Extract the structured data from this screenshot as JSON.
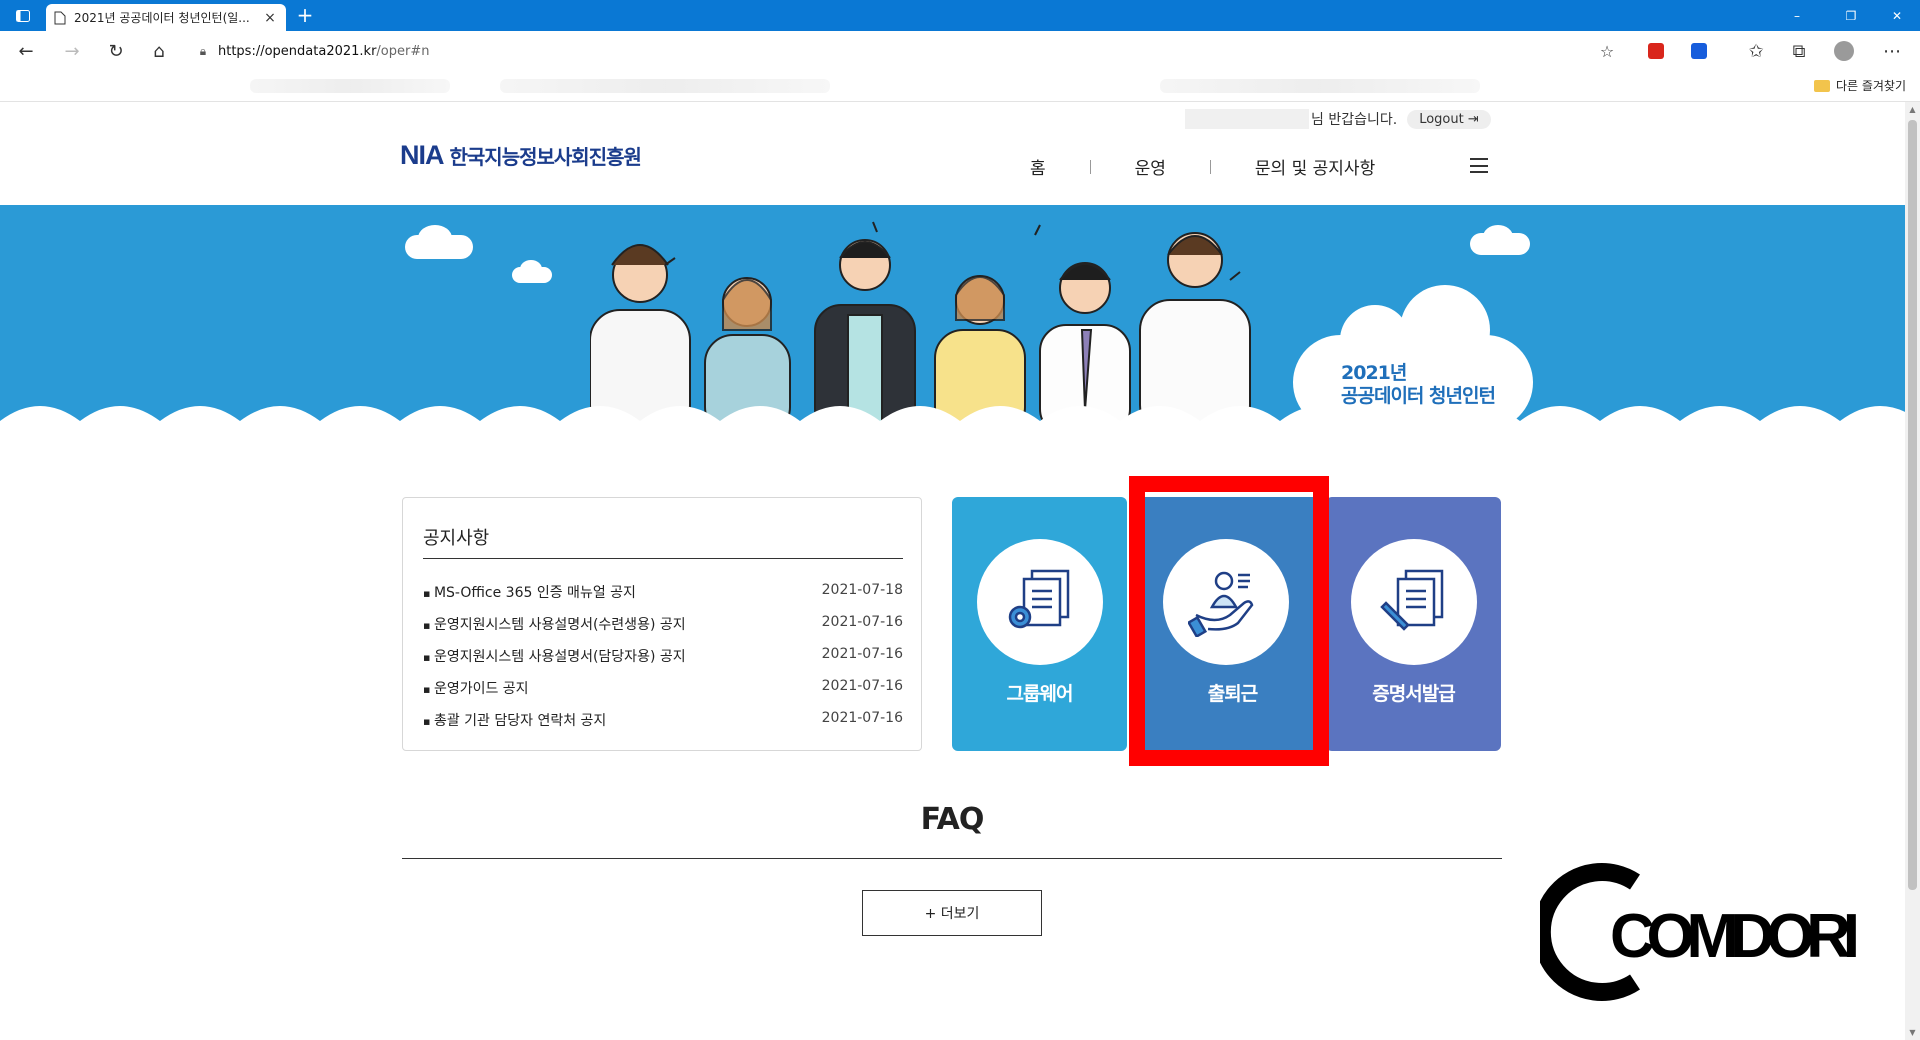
{
  "browser": {
    "tab_title": "2021년 공공데이터 청년인턴(일...",
    "tab_close": "×",
    "newtab": "+",
    "url_host": "https://opendata2021.kr",
    "url_path": "/oper#n",
    "other_favorites": "다른 즐겨찾기",
    "window_controls": {
      "minimize": "–",
      "restore": "❐",
      "close": "✕"
    }
  },
  "header": {
    "greeting": "님 반갑습니다.",
    "logout": "Logout",
    "logo_abbr": "NIA",
    "logo_org": "한국지능정보사회진흥원",
    "nav": [
      "홈",
      "운영",
      "문의 및 공지사항"
    ]
  },
  "banner": {
    "line1": "2021년",
    "line2": "공공데이터 청년인턴"
  },
  "notice": {
    "title": "공지사항",
    "items": [
      {
        "title": "MS-Office 365 인증 매뉴얼 공지",
        "date": "2021-07-18"
      },
      {
        "title": "운영지원시스템 사용설명서(수련생용) 공지",
        "date": "2021-07-16"
      },
      {
        "title": "운영지원시스템 사용설명서(담당자용) 공지",
        "date": "2021-07-16"
      },
      {
        "title": "운영가이드 공지",
        "date": "2021-07-16"
      },
      {
        "title": "총괄 기관 담당자 연락처 공지",
        "date": "2021-07-16"
      }
    ]
  },
  "cards": [
    {
      "label": "그룹웨어",
      "icon": "documents-gear-icon",
      "color": "#2fa7d9"
    },
    {
      "label": "출퇴근",
      "icon": "hand-person-icon",
      "color": "#3a7fc1"
    },
    {
      "label": "증명서발급",
      "icon": "certificate-pen-icon",
      "color": "#5b74c0"
    }
  ],
  "faq": {
    "title": "FAQ",
    "more": "+ 더보기"
  },
  "watermark": "COMDORI",
  "colors": {
    "browser_blue": "#0a78d4",
    "banner_blue": "#2b9ad6",
    "logo_navy": "#1b3c8c",
    "highlight_red": "#ff0000"
  }
}
